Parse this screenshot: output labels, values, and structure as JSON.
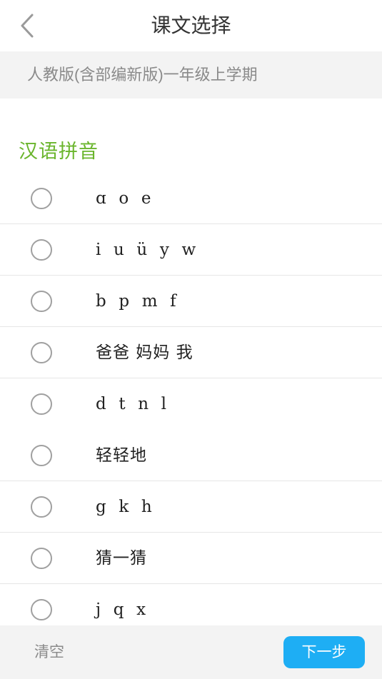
{
  "header": {
    "title": "课文选择",
    "back_icon": "chevron-left-icon"
  },
  "edition": {
    "label": "人教版(含部编新版)一年级上学期"
  },
  "section": {
    "title": "汉语拼音",
    "accent_color": "#6ab52c"
  },
  "lessons": [
    {
      "label": "ɑ  o  e",
      "selected": false
    },
    {
      "label": "i  u  ü  y  w",
      "selected": false
    },
    {
      "label": "b  p  m  f",
      "selected": false
    },
    {
      "label": "爸爸 妈妈 我",
      "selected": false
    },
    {
      "label": "d  t  n  l",
      "selected": false
    },
    {
      "label": "轻轻地",
      "selected": false
    },
    {
      "label": "g  k  h",
      "selected": false
    },
    {
      "label": "猜一猜",
      "selected": false
    },
    {
      "label": "j  q  x",
      "selected": false
    }
  ],
  "footer": {
    "clear_label": "清空",
    "next_label": "下一步",
    "next_color": "#1eaef4"
  }
}
